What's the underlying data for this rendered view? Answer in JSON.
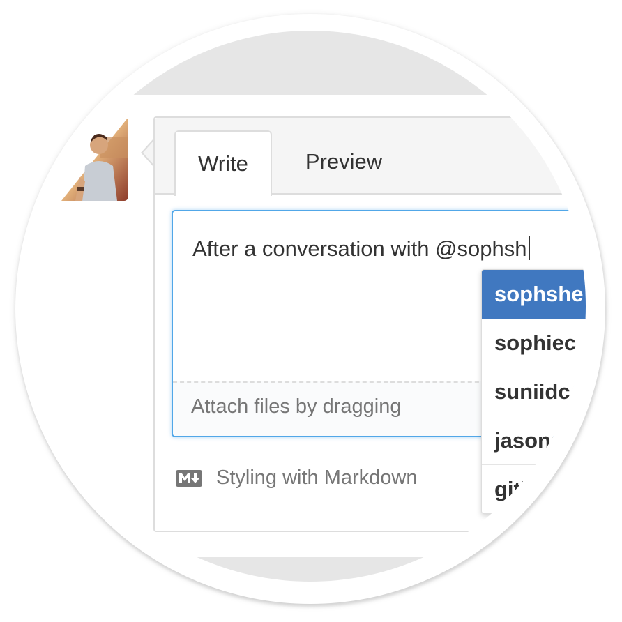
{
  "tabs": {
    "write": "Write",
    "preview": "Preview"
  },
  "editor": {
    "value": "After a conversation with @sophsh",
    "dropzone": "Attach files by dragging"
  },
  "markdown_hint": {
    "label": "Styling with Markdown"
  },
  "suggestions": [
    {
      "username": "sophshe",
      "selected": true
    },
    {
      "username": "sophiec",
      "selected": false
    },
    {
      "username": "suniidc",
      "selected": false
    },
    {
      "username": "jasonr",
      "selected": false
    },
    {
      "username": "gith",
      "selected": false
    }
  ],
  "colors": {
    "accent": "#4078c0",
    "focus_border": "#51a7e8",
    "tab_bar": "#f5f5f5"
  },
  "icons": {
    "markdown": "markdown-icon",
    "avatar": "user-avatar"
  }
}
